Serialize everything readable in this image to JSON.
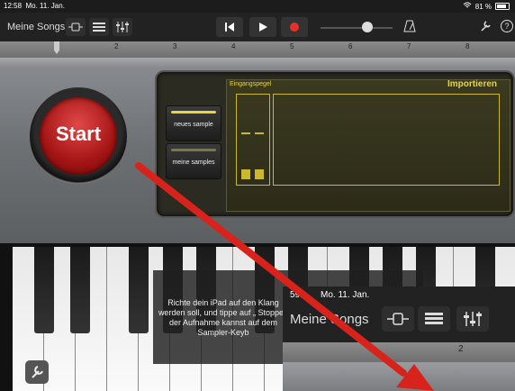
{
  "status_bar": {
    "time": "12:58",
    "date": "Mo. 11. Jan.",
    "battery": "81 %"
  },
  "toolbar": {
    "my_songs": "Meine Songs"
  },
  "ruler": {
    "bars": [
      "2",
      "3",
      "4",
      "5",
      "6",
      "7",
      "8"
    ]
  },
  "instrument": {
    "start_label": "Start",
    "new_sample": "neues sample",
    "my_samples": "meine samples",
    "input_level": "Eingangspegel",
    "import": "Importieren"
  },
  "overlay": {
    "hint_text": "Richte dein iPad auf den Klang werden soll, und tippe auf „ Stoppen der Aufnahme kannst auf dem Sampler-Keyb"
  },
  "pip": {
    "time": "59",
    "date": "Mo. 11. Jan.",
    "my_songs": "Meine Songs",
    "ruler_bar": "2"
  },
  "colors": {
    "accent": "#e8d63a",
    "record": "#e8302a",
    "arrow": "#d8231c"
  }
}
